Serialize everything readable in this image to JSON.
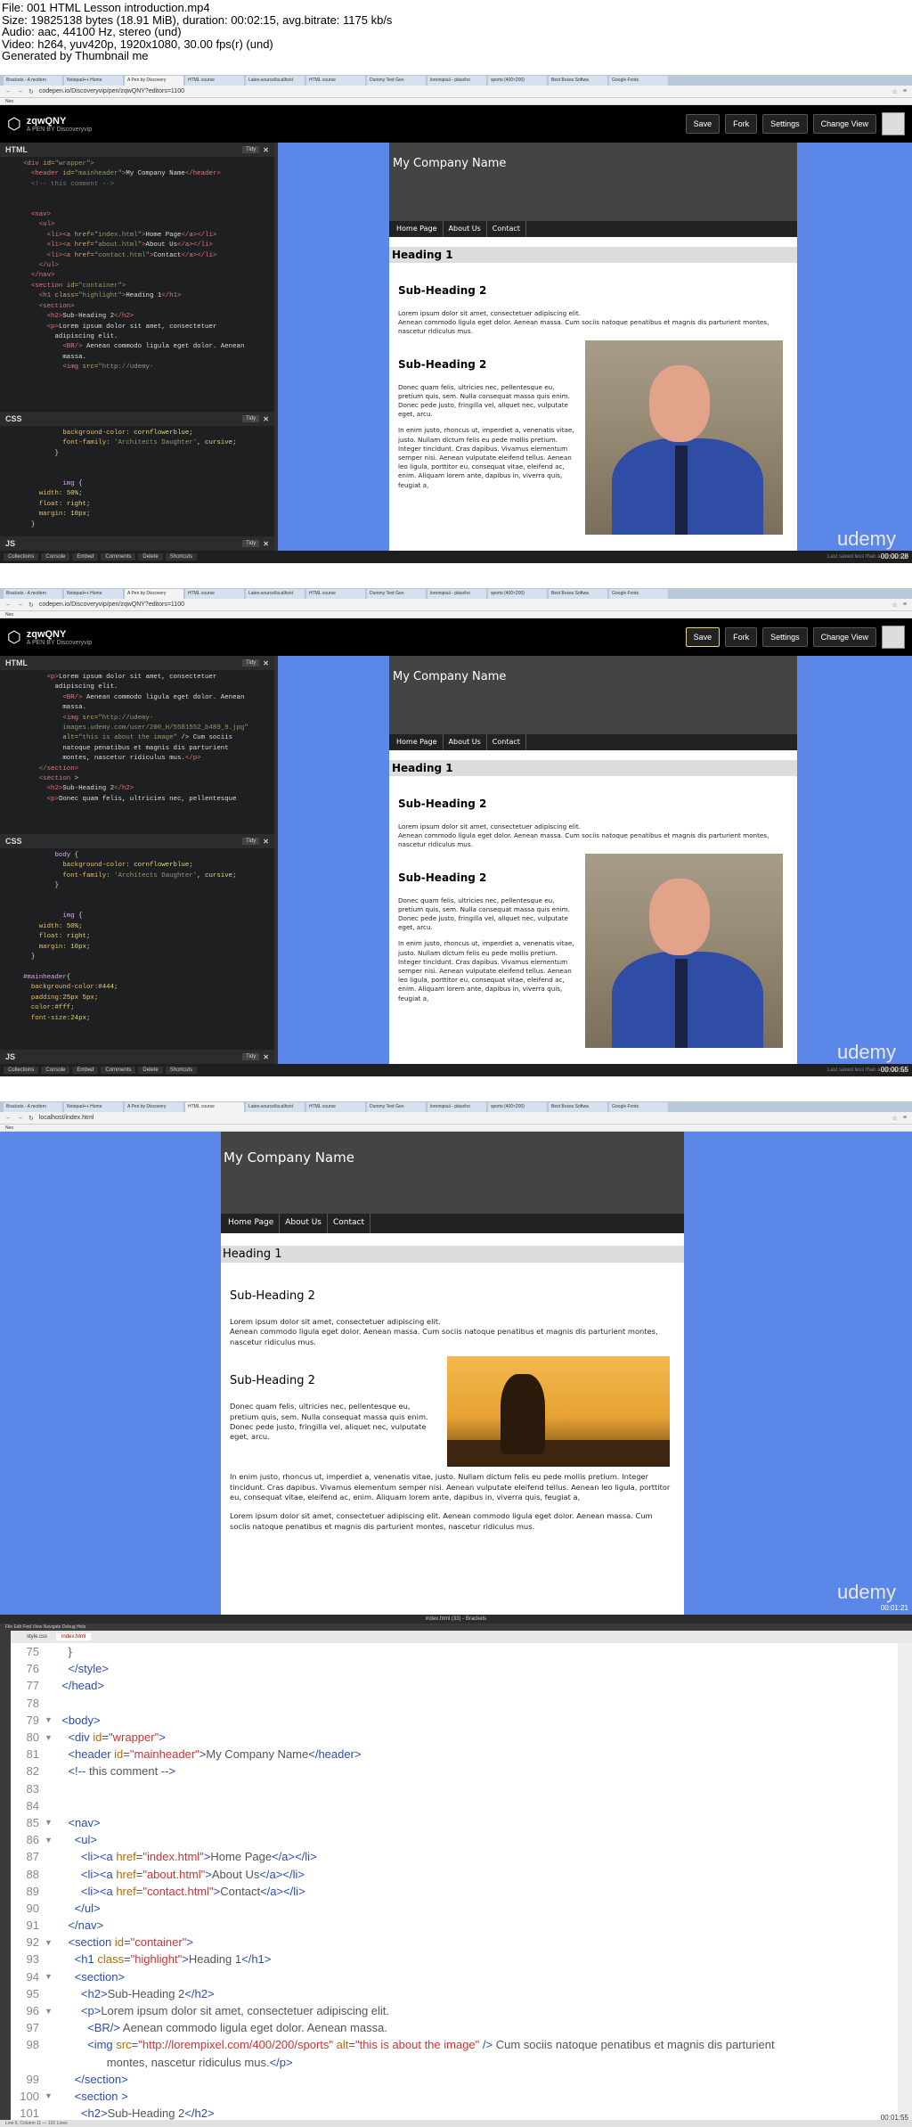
{
  "info": [
    "File: 001 HTML Lesson introduction.mp4",
    "Size: 19825138 bytes (18.91 MiB), duration: 00:02:15, avg.bitrate: 1175 kb/s",
    "Audio: aac, 44100 Hz, stereo (und)",
    "Video: h264, yuv420p, 1920x1080, 30.00 fps(r) (und)",
    "Generated by Thumbnail me"
  ],
  "browser": {
    "tabs": [
      "Brackets - A modern",
      "Notepad++ Home",
      "A Pen by Discovery",
      "HTML course",
      "Latex-source/localhost",
      "HTML course",
      "Dummy Text Gen",
      "loremipsul - placeho",
      "sports (400×200)",
      "Best Boxes Softwa",
      "Google Fonts"
    ],
    "codepen_url": "codepen.io/Discoveryvip/pen/zqwQNY?editors=1100",
    "localhost_url": "localhost/index.html",
    "bookmarks": "Neo"
  },
  "codepen": {
    "pen_title": "zqwQNY",
    "pen_sub": "A PEN BY Discoveryvip",
    "buttons": {
      "save": "Save",
      "fork": "Fork",
      "settings": "Settings",
      "change_view": "Change View"
    },
    "panes": {
      "html": "HTML",
      "css": "CSS",
      "js": "JS",
      "tidy": "Tidy"
    },
    "footer": {
      "collections": "Collections",
      "console": "Console",
      "embed": "Embed",
      "comments": "Comments",
      "delete": "Delete",
      "shortcuts": "Shortcuts",
      "saved": "Last saved less than a minute ago"
    }
  },
  "preview": {
    "company": "My Company Name",
    "nav": [
      "Home Page",
      "About Us",
      "Contact"
    ],
    "h1": "Heading 1",
    "h2": "Sub-Heading 2",
    "p1": "Lorem ipsum dolor sit amet, consectetuer adipiscing elit.",
    "p1b": "Aenean commodo ligula eget dolor. Aenean massa. Cum sociis natoque penatibus et magnis dis parturient montes, nascetur ridiculus mus.",
    "p2": "Donec quam felis, ultricies nec, pellentesque eu, pretium quis, sem. Nulla consequat massa quis enim. Donec pede justo, fringilla vel, aliquet nec, vulputate eget, arcu.",
    "p3": "In enim justo, rhoncus ut, imperdiet a, venenatis vitae, justo. Nullam dictum felis eu pede mollis pretium. Integer tincidunt. Cras dapibus. Vivamus elementum semper nisi. Aenean vulputate eleifend tellus. Aenean leo ligula, porttitor eu, consequat vitae, eleifend ac, enim. Aliquam lorem ante, dapibus in, viverra quis, feugiat a,",
    "p4": "Lorem ipsum dolor sit amet, consectetuer adipiscing elit. Aenean commodo ligula eget dolor. Aenean massa. Cum sociis natoque penatibus et magnis dis parturient montes, nascetur ridiculus mus."
  },
  "timestamps": [
    "00:00:28",
    "00:00:55",
    "00:01:21",
    "00:01:55"
  ],
  "watermark": "udemy",
  "brackets": {
    "title": "index.html (33) - Brackets",
    "menu": "File  Edit  Find  View  Navigate  Debug  Help",
    "tabs": [
      "style.css",
      "index.html"
    ],
    "status": "Line 6, Column 11 — 101 Lines",
    "lines": [
      {
        "n": "75",
        "code": "    }"
      },
      {
        "n": "76",
        "code": "    </style>"
      },
      {
        "n": "77",
        "code": "  </head>"
      },
      {
        "n": "78",
        "code": ""
      },
      {
        "n": "79",
        "code": "  <body>"
      },
      {
        "n": "80",
        "code": "    <div id=\"wrapper\">"
      },
      {
        "n": "81",
        "code": "    <header id=\"mainheader\">My Company Name</header>"
      },
      {
        "n": "82",
        "code": "    <!-- this comment -->"
      },
      {
        "n": "83",
        "code": ""
      },
      {
        "n": "84",
        "code": ""
      },
      {
        "n": "85",
        "code": "    <nav>"
      },
      {
        "n": "86",
        "code": "      <ul>"
      },
      {
        "n": "87",
        "code": "        <li><a href=\"index.html\">Home Page</a></li>"
      },
      {
        "n": "88",
        "code": "        <li><a href=\"about.html\">About Us</a></li>"
      },
      {
        "n": "89",
        "code": "        <li><a href=\"contact.html\">Contact</a></li>"
      },
      {
        "n": "90",
        "code": "      </ul>"
      },
      {
        "n": "91",
        "code": "    </nav>"
      },
      {
        "n": "92",
        "code": "    <section id=\"container\">"
      },
      {
        "n": "93",
        "code": "      <h1 class=\"highlight\">Heading 1</h1>"
      },
      {
        "n": "94",
        "code": "      <section>"
      },
      {
        "n": "95",
        "code": "        <h2>Sub-Heading 2</h2>"
      },
      {
        "n": "96",
        "code": "        <p>Lorem ipsum dolor sit amet, consectetuer adipiscing elit."
      },
      {
        "n": "97",
        "code": "          <BR/> Aenean commodo ligula eget dolor. Aenean massa."
      },
      {
        "n": "98",
        "code": "          <img src=\"http://lorempixel.com/400/200/sports\" alt=\"this is about the image\" /> Cum sociis natoque penatibus et magnis dis parturient"
      },
      {
        "n": "",
        "code": "                montes, nascetur ridiculus mus.</p>"
      },
      {
        "n": "99",
        "code": "      </section>"
      },
      {
        "n": "100",
        "code": "      <section >"
      },
      {
        "n": "101",
        "code": "        <h2>Sub-Heading 2</h2>"
      }
    ]
  }
}
